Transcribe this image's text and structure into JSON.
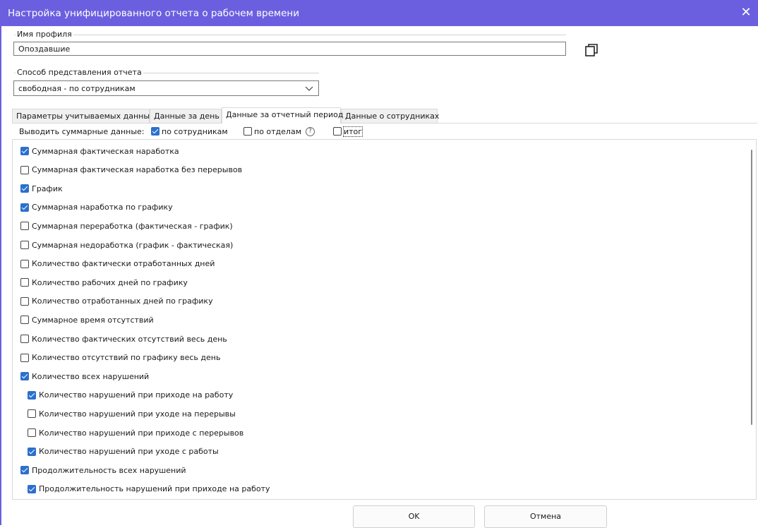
{
  "window": {
    "title": "Настройка унифицированного отчета о рабочем времени"
  },
  "profile": {
    "label": "Имя профиля",
    "value": "Опоздавшие"
  },
  "representation": {
    "label": "Способ представления отчета",
    "value": "свободная - по сотрудникам"
  },
  "tabs": [
    {
      "label": "Параметры учитываемых данных"
    },
    {
      "label": "Данные за день"
    },
    {
      "label": "Данные за отчетный период"
    },
    {
      "label": "Данные о сотрудниках"
    }
  ],
  "summary": {
    "label": "Выводить суммарные данные:",
    "options": [
      {
        "label": "по сотрудникам",
        "checked": true
      },
      {
        "label": "по отделам",
        "checked": false
      },
      {
        "label": "итог",
        "checked": false
      }
    ]
  },
  "items": [
    {
      "label": "Суммарная фактическая наработка",
      "checked": true,
      "indent": 0
    },
    {
      "label": "Суммарная фактическая наработка без перерывов",
      "checked": false,
      "indent": 0
    },
    {
      "label": "График",
      "checked": true,
      "indent": 0
    },
    {
      "label": "Суммарная наработка по графику",
      "checked": true,
      "indent": 0
    },
    {
      "label": "Суммарная переработка (фактическая - график)",
      "checked": false,
      "indent": 0
    },
    {
      "label": "Суммарная недоработка (график - фактическая)",
      "checked": false,
      "indent": 0
    },
    {
      "label": "Количество фактически отработанных дней",
      "checked": false,
      "indent": 0
    },
    {
      "label": "Количество рабочих дней по графику",
      "checked": false,
      "indent": 0
    },
    {
      "label": "Количество отработанных дней по графику",
      "checked": false,
      "indent": 0
    },
    {
      "label": "Суммарное время отсутствий",
      "checked": false,
      "indent": 0
    },
    {
      "label": "Количество фактических отсутствий весь день",
      "checked": false,
      "indent": 0
    },
    {
      "label": "Количество отсутствий по графику весь день",
      "checked": false,
      "indent": 0
    },
    {
      "label": "Количество всех нарушений",
      "checked": true,
      "indent": 0
    },
    {
      "label": "Количество нарушений при приходе на работу",
      "checked": true,
      "indent": 1
    },
    {
      "label": "Количество нарушений при уходе на перерывы",
      "checked": false,
      "indent": 1
    },
    {
      "label": "Количество нарушений при приходе с перерывов",
      "checked": false,
      "indent": 1
    },
    {
      "label": "Количество нарушений при уходе с работы",
      "checked": true,
      "indent": 1
    },
    {
      "label": "Продолжительность всех нарушений",
      "checked": true,
      "indent": 0
    },
    {
      "label": "Продолжительность нарушений при приходе на работу",
      "checked": true,
      "indent": 1
    }
  ],
  "buttons": {
    "ok": "OK",
    "cancel": "Отмена"
  }
}
